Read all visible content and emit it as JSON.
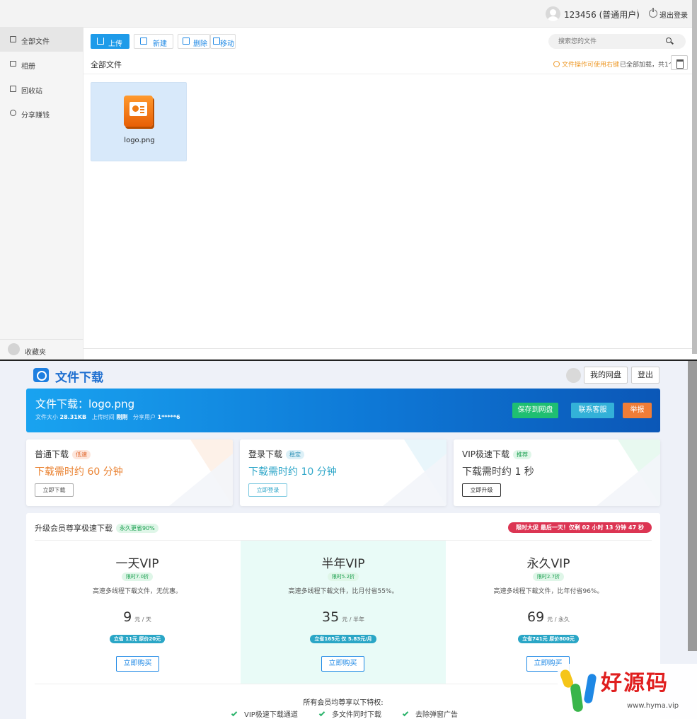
{
  "app": {
    "user_name": "123456 (普通用户)",
    "logout_label": "退出登录",
    "sidebar": [
      {
        "label": "全部文件",
        "icon": "files-icon",
        "active": true
      },
      {
        "label": "相册",
        "icon": "monitor-icon",
        "active": false
      },
      {
        "label": "回收站",
        "icon": "trash-icon",
        "active": false
      },
      {
        "label": "分享赚钱",
        "icon": "share-icon",
        "active": false
      }
    ],
    "sidebar_footer": "收藏夹",
    "toolbar": {
      "upload": "上传",
      "new": "新建",
      "delete": "删除",
      "move": "移动"
    },
    "search_placeholder": "搜索您的文件",
    "breadcrumb": "全部文件",
    "tip": "文件操作可使用右键",
    "loaded_status": "已全部加载，共1个",
    "files": [
      {
        "name": "logo.png"
      }
    ]
  },
  "download": {
    "site_title": "文件下载",
    "my_disk": "我的网盘",
    "login": "登出",
    "heading": "文件下载：logo.png",
    "meta": {
      "size_label": "文件大小",
      "size": "28.31KB",
      "time_label": "上传时间",
      "time": "刚刚",
      "sharer_label": "分享用户",
      "sharer": "1*****6"
    },
    "actions": {
      "save": "保存到网盘",
      "contact": "联系客服",
      "report": "举报"
    },
    "colors": {
      "save": "#1fbf72",
      "contact": "#33b1d8",
      "report": "#f07d37"
    },
    "cards": [
      {
        "title": "普通下载",
        "badge": "低速",
        "time": "下载需时约 60 分钟",
        "button": "立即下载"
      },
      {
        "title": "登录下载",
        "badge": "稳定",
        "time": "下载需时约 10 分钟",
        "button": "立即登录"
      },
      {
        "title": "VIP极速下载",
        "badge": "推荐",
        "time": "下载需时约 1 秒",
        "button": "立即升级"
      }
    ],
    "vip": {
      "title": "升级会员尊享极速下载",
      "title_badge": "永久更省90%",
      "promo": "限时大促 最后一天！仅剩 02 小时 13 分钟 47 秒",
      "plans": [
        {
          "name": "一天VIP",
          "discount": "限时7.0折",
          "desc": "高速多线程下载文件，无优惠。",
          "price": "9",
          "unit": "元 / 天",
          "save": "立省 11元 原价20元",
          "buy": "立即购买"
        },
        {
          "name": "半年VIP",
          "discount": "限时5.2折",
          "desc": "高速多线程下载文件，比月付省55%。",
          "price": "35",
          "unit": "元 / 半年",
          "save": "立省165元 仅 5.83元/月",
          "buy": "立即购买"
        },
        {
          "name": "永久VIP",
          "discount": "限时2.7折",
          "desc": "高速多线程下载文件，比年付省96%。",
          "price": "69",
          "unit": "元 / 永久",
          "save": "立省741元 原价800元",
          "buy": "立即购买"
        }
      ],
      "perks_title": "所有会员均尊享以下特权:",
      "perks": [
        "VIP极速下载通道",
        "多文件同时下载",
        "去除弹窗广告"
      ]
    }
  },
  "watermark": {
    "text": "好源码",
    "url": "www.hyma.vip"
  }
}
